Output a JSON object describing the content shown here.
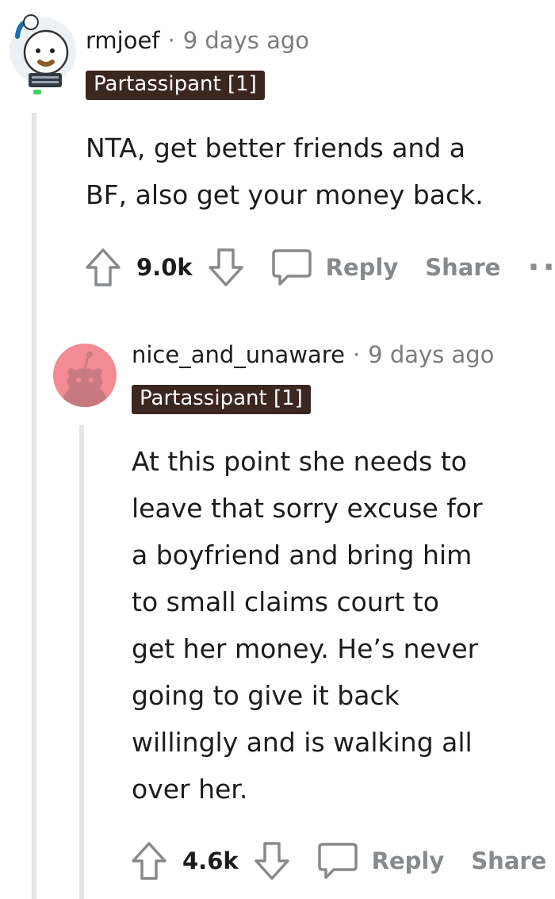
{
  "comments": [
    {
      "username": "rmjoef",
      "separator": "·",
      "timestamp": "9 days ago",
      "flair": "Partassipant [1]",
      "body_lines": [
        "NTA, get better friends and a",
        "BF, also get your money back."
      ],
      "score": "9.0k",
      "reply_label": "Reply",
      "share_label": "Share",
      "more_label": "··"
    },
    {
      "username": "nice_and_unaware",
      "separator": "·",
      "timestamp": "9 days ago",
      "flair": "Partassipant [1]",
      "body_lines": [
        "At this point she needs to",
        "leave that sorry excuse for",
        "a boyfriend and bring him",
        "to small claims court to",
        "get her money. He’s never",
        "going to give it back",
        "willingly and is walking all",
        "over her."
      ],
      "score": "4.6k",
      "reply_label": "Reply",
      "share_label": "Share"
    }
  ],
  "colors": {
    "flair_bg": "#3b2620",
    "muted_text": "#7c7c7c",
    "action_gray": "#878a8c",
    "avatar_pink": "#f28b94",
    "thread_line": "#e5e5e5",
    "online_dot": "#46d160"
  },
  "icons": {
    "upvote": "arrow-up-outline-icon",
    "downvote": "arrow-down-outline-icon",
    "reply": "speech-bubble-icon"
  }
}
